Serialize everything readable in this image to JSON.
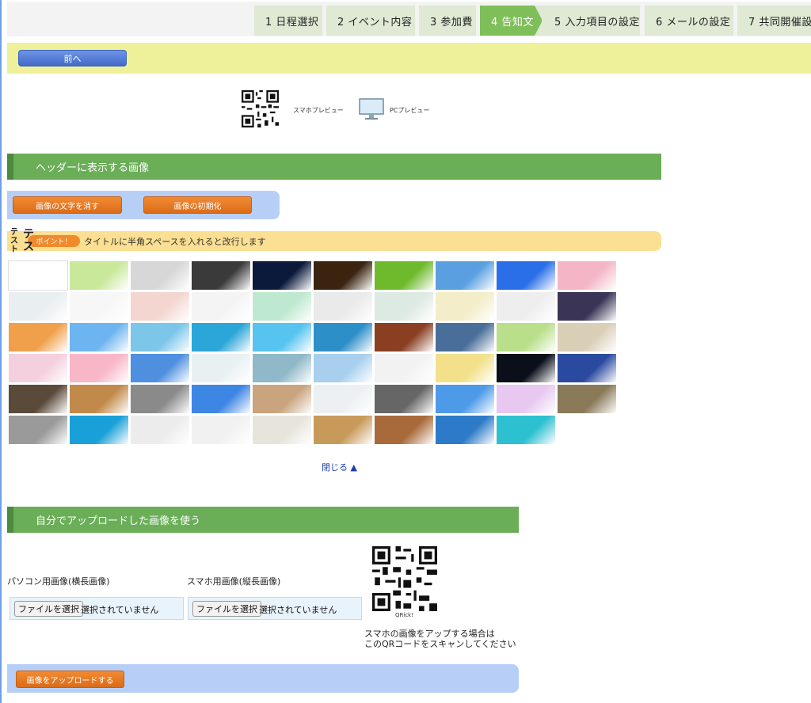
{
  "steps": [
    {
      "label": "1 日程選択",
      "active": false
    },
    {
      "label": "2 イベント内容",
      "active": false
    },
    {
      "label": "3 参加費",
      "active": false
    },
    {
      "label": "4 告知文",
      "active": true
    },
    {
      "label": "5 入力項目の設定",
      "active": false
    },
    {
      "label": "6 メールの設定",
      "active": false
    },
    {
      "label": "7 共同開催設定",
      "active": false
    }
  ],
  "nav": {
    "prev_label": "前へ"
  },
  "preview": {
    "mobile_label": "スマホプレビュー",
    "pc_label": "PCプレビュー"
  },
  "header_image": {
    "title": "ヘッダーに表示する画像",
    "clear_text_label": "画像の文字を消す",
    "reset_label": "画像の初期化",
    "point_badge": "ポイント！",
    "point_text": "タイトルに半角スペースを入れると改行します",
    "vertical_small": "テスト",
    "vertical_big": "テス",
    "close_label": "閉じる ▲"
  },
  "thumbnails": [
    [
      "#ffffff",
      "#c9e89a",
      "#d7d7d7",
      "#3a3a3a",
      "#0b1a3a",
      "#3a2410",
      "#6fba2c",
      "#5aa0e0",
      "#2b6fe8",
      "#f4b6c6"
    ],
    [
      "#e9eef0",
      "#f7f7f7",
      "#f3d6d0",
      "#f4f4f4",
      "#bfe8d0",
      "#eaeaea",
      "#dde9e3",
      "#f3edc9",
      "#eeeeee",
      "#3a3556"
    ],
    [
      "#f0a04a",
      "#6db5f0",
      "#7cc6ea",
      "#2aa6d8",
      "#56c3f0",
      "#2d8fc8",
      "#8a3e22",
      "#4a6e9a",
      "#b9df8a",
      "#d9cfb7"
    ],
    [
      "#f4cfdd",
      "#f7b7c7",
      "#4f8fe0",
      "#e9f0f2",
      "#8fb9c8",
      "#a8d0ee",
      "#f2f2f2",
      "#f2e08a",
      "#0a0f1a",
      "#2a4aa0"
    ],
    [
      "#5a4a3a",
      "#c28a4a",
      "#8a8a8a",
      "#3e86e4",
      "#c9a47e",
      "#ecf0f2",
      "#666666",
      "#4d9ae8",
      "#e8c8f0",
      "#8a7a5a"
    ],
    [
      "#9a9a9a",
      "#1aa0d8",
      "#ececec",
      "#f1f1f1",
      "#e7e4dc",
      "#c89a5a",
      "#a86a3a",
      "#2c7ac8",
      "#2cc0d0"
    ]
  ],
  "upload": {
    "title": "自分でアップロードした画像を使う",
    "pc_label": "パソコン用画像(横長画像)",
    "sp_label": "スマホ用画像(縦長画像)",
    "choose_file": "ファイルを選択",
    "no_file": "選択されていません",
    "qr_caption": "QRick!",
    "scan_line1": "スマホの画像をアップする場合は",
    "scan_line2": "このQRコードをスキャンしてください",
    "upload_button": "画像をアップロードする"
  },
  "colors": {
    "active_step": "#7fbf5a",
    "section_green": "#6aae58",
    "orange": "#f28b34",
    "blue_panel": "#b7cff6"
  }
}
